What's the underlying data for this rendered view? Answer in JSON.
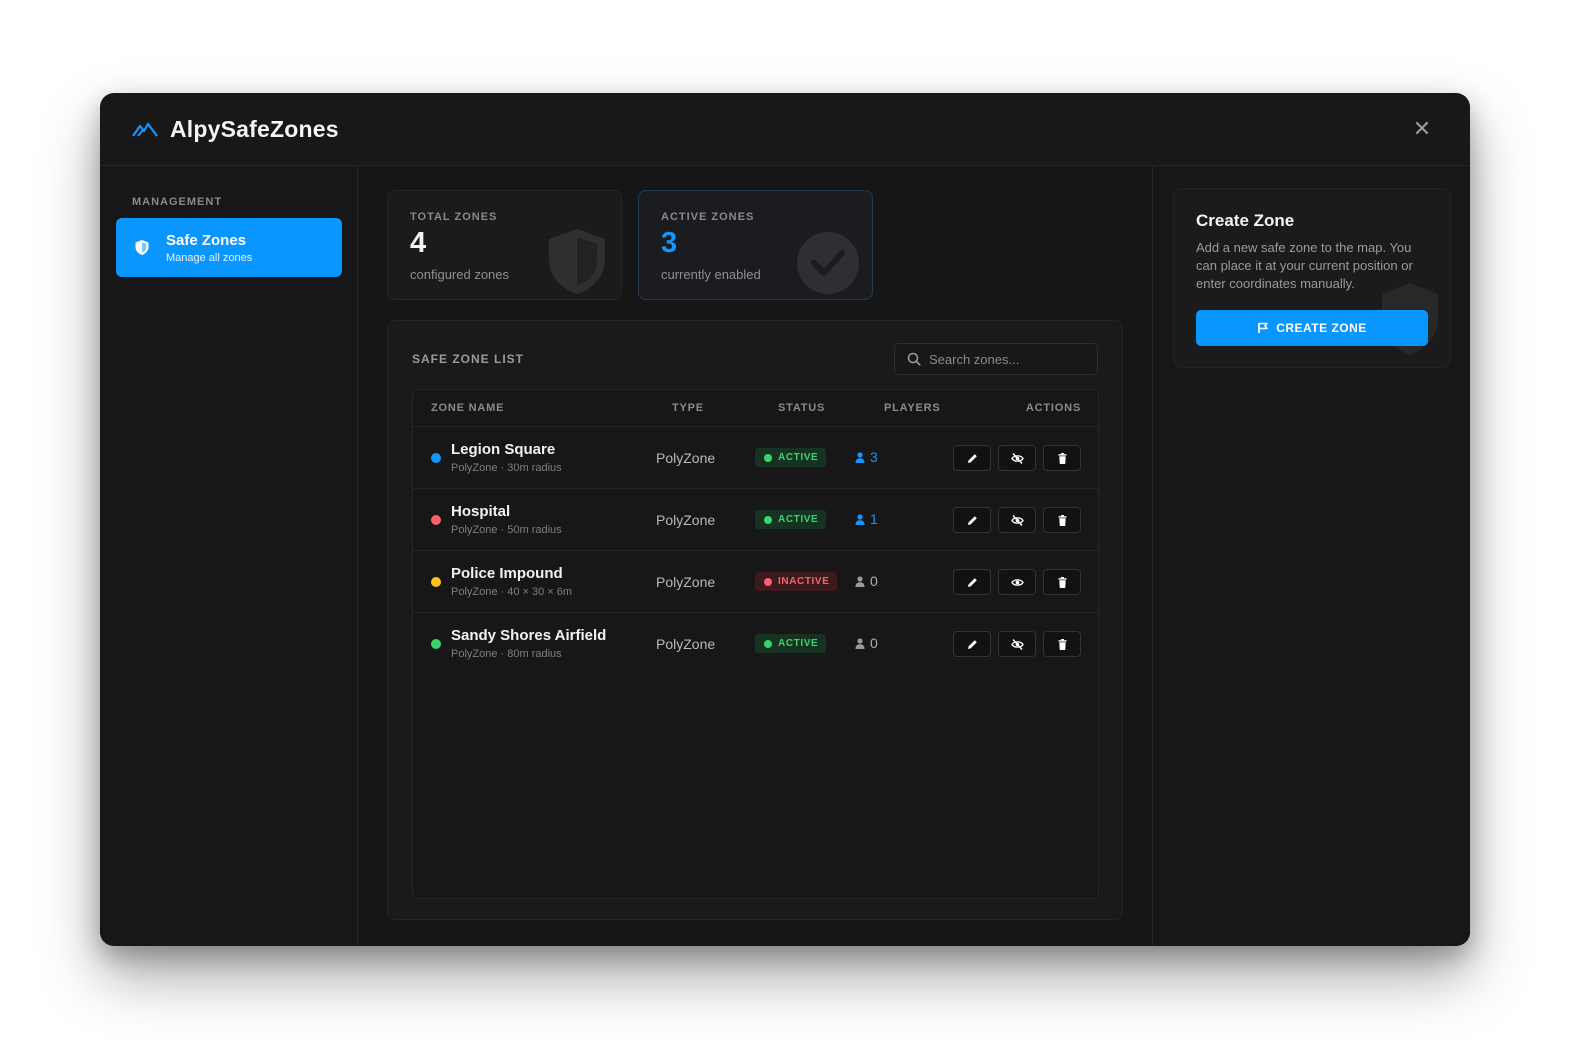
{
  "app": {
    "title": "AlpySafeZones",
    "close_symbol": "✕",
    "accent": "#0a96ff"
  },
  "sidebar": {
    "section_label": "MANAGEMENT",
    "items": [
      {
        "title": "Safe Zones",
        "subtitle": "Manage all zones",
        "icon": "shield-icon",
        "selected": true
      }
    ]
  },
  "stats": {
    "total": {
      "label": "TOTAL ZONES",
      "value": "4",
      "sub": "configured zones",
      "icon": "shield-icon"
    },
    "active": {
      "label": "ACTIVE ZONES",
      "value": "3",
      "sub": "currently enabled",
      "icon": "check-circle-icon"
    }
  },
  "list": {
    "title": "SAFE ZONE LIST",
    "search_placeholder": "Search zones...",
    "columns": {
      "name": "ZONE NAME",
      "type": "TYPE",
      "status": "STATUS",
      "players": "PLAYERS",
      "actions": "ACTIONS"
    },
    "rows": [
      {
        "name": "Legion Square",
        "sub": "PolyZone · 30m radius",
        "type": "PolyZone",
        "status": "ACTIVE",
        "players": "3",
        "color": "#1596ff"
      },
      {
        "name": "Hospital",
        "sub": "PolyZone · 50m radius",
        "type": "PolyZone",
        "status": "ACTIVE",
        "players": "1",
        "color": "#ff5f6b"
      },
      {
        "name": "Police Impound",
        "sub": "PolyZone · 40 × 30 × 6m",
        "type": "PolyZone",
        "status": "INACTIVE",
        "players": "0",
        "color": "#ffc21a"
      },
      {
        "name": "Sandy Shores Airfield",
        "sub": "PolyZone · 80m radius",
        "type": "PolyZone",
        "status": "ACTIVE",
        "players": "0",
        "color": "#39d46c"
      }
    ]
  },
  "create": {
    "title": "Create Zone",
    "description": "Add a new safe zone to the map. You can place it at your current position or enter coordinates manually.",
    "button": "CREATE ZONE",
    "button_icon": "map-pin-icon"
  }
}
